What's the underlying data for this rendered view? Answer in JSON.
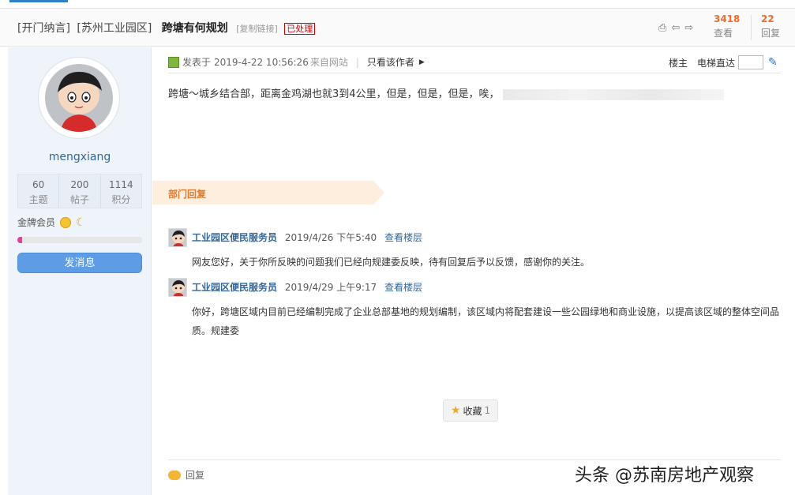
{
  "header": {
    "forum_tag_1": "[开门纳言]",
    "forum_tag_2": "[苏州工业园区]",
    "subject": "跨塘有何规划",
    "copy_link": "[复制链接]",
    "status_badge": "已处理",
    "views_count": "3418",
    "views_label": "查看",
    "replies_count": "22",
    "replies_label": "回复",
    "icons": [
      "print-icon",
      "prev-thread-icon",
      "next-thread-icon"
    ]
  },
  "sidebar": {
    "username": "mengxiang",
    "stats": [
      {
        "value": "60",
        "label": "主题"
      },
      {
        "value": "200",
        "label": "帖子"
      },
      {
        "value": "1114",
        "label": "积分"
      }
    ],
    "member_label": "金牌会员",
    "level_progress": 0.04,
    "message_button": "发消息"
  },
  "post": {
    "posted_prefix": "发表于",
    "posted_time": "2019-4-22 10:56:26",
    "posted_source": "来自网站",
    "author_only": "只看该作者",
    "floor_label": "楼主",
    "jump_label": "电梯直达",
    "content": "跨塘～城乡结合部，距离金鸡湖也就3到4公里，但是，但是，但是，唉，"
  },
  "replies_section": {
    "title": "部门回复",
    "replies": [
      {
        "name": "工业园区便民服务员",
        "date": "2019/4/26 下午5:40",
        "view_link": "查看楼层",
        "body": "网友您好，关于你所反映的问题我们已经向规建委反映，待有回复后予以反馈，感谢你的关注。"
      },
      {
        "name": "工业园区便民服务员",
        "date": "2019/4/29 上午9:17",
        "view_link": "查看楼层",
        "body": "你好，跨塘区域内目前已经编制完成了企业总部基地的规划编制，该区域内将配套建设一些公园绿地和商业设施，以提高该区域的整体空间品质。规建委"
      }
    ]
  },
  "favorite": {
    "label": "收藏",
    "count": "1"
  },
  "reply_link": "回复",
  "watermark": "头条 @苏南房地产观察"
}
